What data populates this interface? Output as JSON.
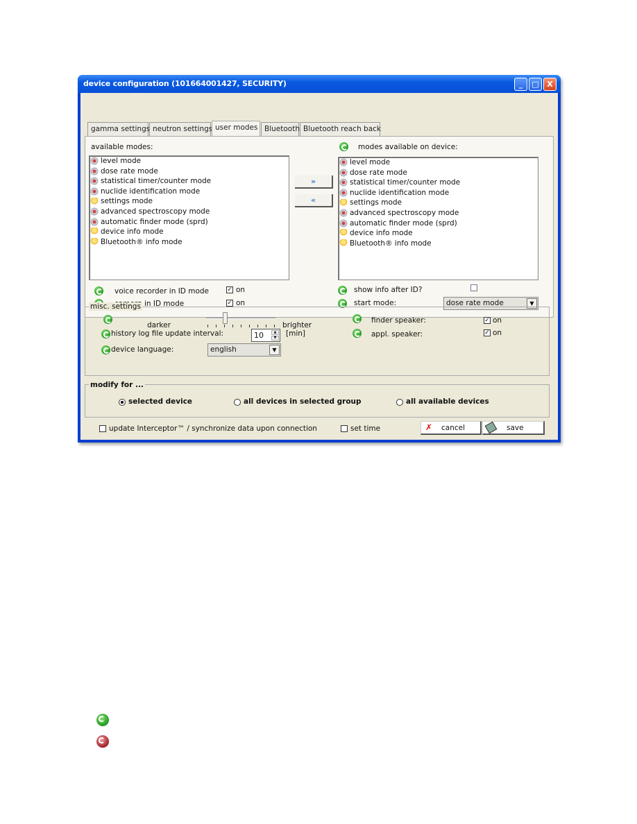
{
  "window": {
    "title": "device configuration  (101664001427, SECURITY)",
    "minimize": "_",
    "maximize": "□",
    "close": "X"
  },
  "tabs": [
    {
      "label": "gamma settings"
    },
    {
      "label": "neutron settings"
    },
    {
      "label": "user modes",
      "active": true
    },
    {
      "label": "Bluetooth"
    },
    {
      "label": "Bluetooth reach back"
    }
  ],
  "user_modes": {
    "available_label": "available modes:",
    "device_label": "modes available on device:",
    "available": [
      {
        "label": "level mode",
        "icon": "atom-icon"
      },
      {
        "label": "dose rate mode",
        "icon": "atom-icon"
      },
      {
        "label": "statistical timer/counter mode",
        "icon": "atom-icon"
      },
      {
        "label": "nuclide identification mode",
        "icon": "atom-icon"
      },
      {
        "label": "settings mode",
        "icon": "bulb-icon"
      },
      {
        "label": "advanced spectroscopy mode",
        "icon": "atom-icon"
      },
      {
        "label": "automatic finder mode (sprd)",
        "icon": "atom-icon"
      },
      {
        "label": "device info mode",
        "icon": "bulb-icon"
      },
      {
        "label": "Bluetooth® info mode",
        "icon": "bulb-icon"
      }
    ],
    "device": [
      {
        "label": "level mode",
        "icon": "atom-icon"
      },
      {
        "label": "dose rate mode",
        "icon": "atom-icon"
      },
      {
        "label": "statistical timer/counter mode",
        "icon": "atom-icon"
      },
      {
        "label": "nuclide identification mode",
        "icon": "atom-icon"
      },
      {
        "label": "settings mode",
        "icon": "bulb-icon"
      },
      {
        "label": "advanced spectroscopy mode",
        "icon": "atom-icon"
      },
      {
        "label": "automatic finder mode (sprd)",
        "icon": "atom-icon"
      },
      {
        "label": "device info mode",
        "icon": "bulb-icon"
      },
      {
        "label": "Bluetooth® info mode",
        "icon": "bulb-icon"
      }
    ],
    "add_button": "»",
    "remove_button": "«",
    "voice_recorder_label": "voice recorder in ID mode",
    "voice_recorder_on": "on",
    "voice_recorder_checked": true,
    "camera_label": "camera in ID mode",
    "camera_on": "on",
    "camera_checked": true,
    "show_info_label": "show info after ID?",
    "show_info_checked": false,
    "start_mode_label": "start mode:",
    "start_mode_value": "dose rate mode"
  },
  "misc": {
    "legend": "misc. settings",
    "darker": "darker",
    "brighter": "brighter",
    "brightness_level": 0.25,
    "history_label": "history log file update interval:",
    "history_value": "10",
    "history_unit": "[min]",
    "language_label": "device language:",
    "language_value": "english",
    "finder_speaker_label": "finder speaker:",
    "finder_speaker_on": "on",
    "appl_speaker_label": "appl. speaker:",
    "appl_speaker_on": "on"
  },
  "modify": {
    "legend": "modify for ...",
    "options": [
      {
        "label": "selected device",
        "selected": true
      },
      {
        "label": "all devices in selected group"
      },
      {
        "label": "all available devices"
      }
    ]
  },
  "footer": {
    "update_label": "update Interceptor™ / synchronize data upon connection",
    "set_time_label": "set time",
    "cancel": "cancel",
    "save": "save"
  },
  "colors": {
    "titlebar": "#0a5ae0",
    "sync_green": "#1f9a1f",
    "sync_red": "#a0202a"
  }
}
